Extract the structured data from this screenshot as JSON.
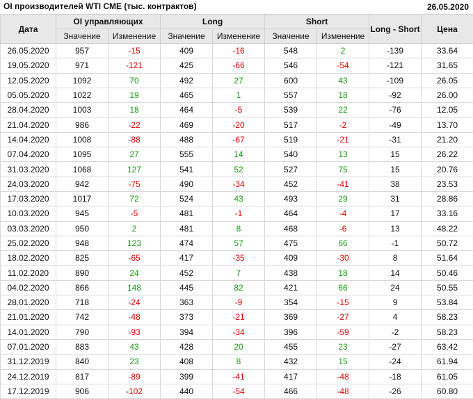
{
  "title": "OI производителей WTI CME (тыс. контрактов)",
  "date": "26.05.2020",
  "headers": {
    "date": "Дата",
    "oi": "OI управляющих",
    "long": "Long",
    "short": "Short",
    "long_short": "Long - Short",
    "price": "Цена",
    "value": "Значение",
    "change": "Изменение"
  },
  "rows": [
    [
      "26.05.2020",
      "957",
      "-15",
      "409",
      "-16",
      "548",
      "2",
      "-139",
      "33.64"
    ],
    [
      "19.05.2020",
      "971",
      "-121",
      "425",
      "-66",
      "546",
      "-54",
      "-121",
      "31.65"
    ],
    [
      "12.05.2020",
      "1092",
      "70",
      "492",
      "27",
      "600",
      "43",
      "-109",
      "26.05"
    ],
    [
      "05.05.2020",
      "1022",
      "19",
      "465",
      "1",
      "557",
      "18",
      "-92",
      "26.00"
    ],
    [
      "28.04.2020",
      "1003",
      "18",
      "464",
      "-5",
      "539",
      "22",
      "-76",
      "12.05"
    ],
    [
      "21.04.2020",
      "986",
      "-22",
      "469",
      "-20",
      "517",
      "-2",
      "-49",
      "13.70"
    ],
    [
      "14.04.2020",
      "1008",
      "-88",
      "488",
      "-67",
      "519",
      "-21",
      "-31",
      "21.20"
    ],
    [
      "07.04.2020",
      "1095",
      "27",
      "555",
      "14",
      "540",
      "13",
      "15",
      "26.22"
    ],
    [
      "31.03.2020",
      "1068",
      "127",
      "541",
      "52",
      "527",
      "75",
      "15",
      "20.76"
    ],
    [
      "24.03.2020",
      "942",
      "-75",
      "490",
      "-34",
      "452",
      "-41",
      "38",
      "23.53"
    ],
    [
      "17.03.2020",
      "1017",
      "72",
      "524",
      "43",
      "493",
      "29",
      "31",
      "28.86"
    ],
    [
      "10.03.2020",
      "945",
      "-5",
      "481",
      "-1",
      "464",
      "-4",
      "17",
      "33.16"
    ],
    [
      "03.03.2020",
      "950",
      "2",
      "481",
      "8",
      "468",
      "-6",
      "13",
      "48.22"
    ],
    [
      "25.02.2020",
      "948",
      "123",
      "474",
      "57",
      "475",
      "66",
      "-1",
      "50.72"
    ],
    [
      "18.02.2020",
      "825",
      "-65",
      "417",
      "-35",
      "409",
      "-30",
      "8",
      "51.64"
    ],
    [
      "11.02.2020",
      "890",
      "24",
      "452",
      "7",
      "438",
      "18",
      "14",
      "50.46"
    ],
    [
      "04.02.2020",
      "866",
      "148",
      "445",
      "82",
      "421",
      "66",
      "24",
      "50.55"
    ],
    [
      "28.01.2020",
      "718",
      "-24",
      "363",
      "-9",
      "354",
      "-15",
      "9",
      "53.84"
    ],
    [
      "21.01.2020",
      "742",
      "-48",
      "373",
      "-21",
      "369",
      "-27",
      "4",
      "58.23"
    ],
    [
      "14.01.2020",
      "790",
      "-93",
      "394",
      "-34",
      "396",
      "-59",
      "-2",
      "58.23"
    ],
    [
      "07.01.2020",
      "883",
      "43",
      "428",
      "20",
      "455",
      "23",
      "-27",
      "63.42"
    ],
    [
      "31.12.2019",
      "840",
      "23",
      "408",
      "8",
      "432",
      "15",
      "-24",
      "61.94"
    ],
    [
      "24.12.2019",
      "817",
      "-89",
      "399",
      "-41",
      "417",
      "-48",
      "-18",
      "61.05"
    ],
    [
      "17.12.2019",
      "906",
      "-102",
      "440",
      "-54",
      "466",
      "-48",
      "-26",
      "60.80"
    ]
  ],
  "colors": {
    "negative": "#e00000",
    "positive": "#1a9a1a",
    "header_bg": "#e8e8e8"
  }
}
